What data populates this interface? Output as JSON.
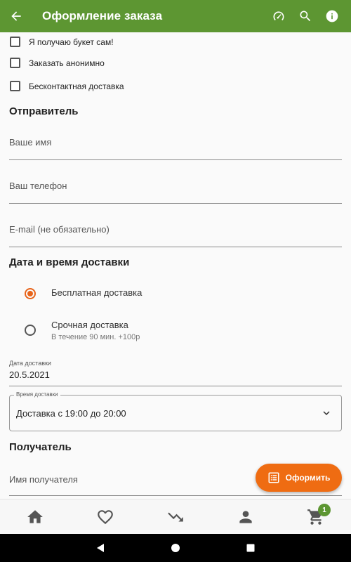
{
  "appbar": {
    "title": "Оформление заказа",
    "icons": [
      "arrow-back-icon",
      "speedometer-icon",
      "search-icon",
      "info-icon"
    ],
    "color": "#5d9632"
  },
  "options": [
    {
      "label": "Я получаю букет сам!",
      "checked": false
    },
    {
      "label": "Заказать анонимно",
      "checked": false
    },
    {
      "label": "Бесконтактная доставка",
      "checked": false
    }
  ],
  "sender": {
    "title": "Отправитель",
    "name_label": "Ваше имя",
    "phone_label": "Ваш телефон",
    "email_label": "E-mail (не обязательно)"
  },
  "delivery": {
    "title": "Дата и время доставки",
    "options": [
      {
        "label": "Бесплатная доставка",
        "sub": "",
        "selected": true
      },
      {
        "label": "Срочная доставка",
        "sub": "В течение 90 мин. +100р",
        "selected": false
      }
    ],
    "date_label": "Дата доставки",
    "date_value": "20.5.2021",
    "time_label": "Время доставки",
    "time_value": "Доставка с 19:00 до 20:00"
  },
  "recipient": {
    "title": "Получатель",
    "name_label": "Имя получателя"
  },
  "fab": {
    "label": "Оформить",
    "icon": "list-alt-icon",
    "color": "#ef6c12"
  },
  "bottom_nav": {
    "items": [
      "home-icon",
      "heart-icon",
      "trending-down-icon",
      "person-icon",
      "cart-icon"
    ],
    "cart_badge": "1"
  },
  "accent": "#e8641a"
}
